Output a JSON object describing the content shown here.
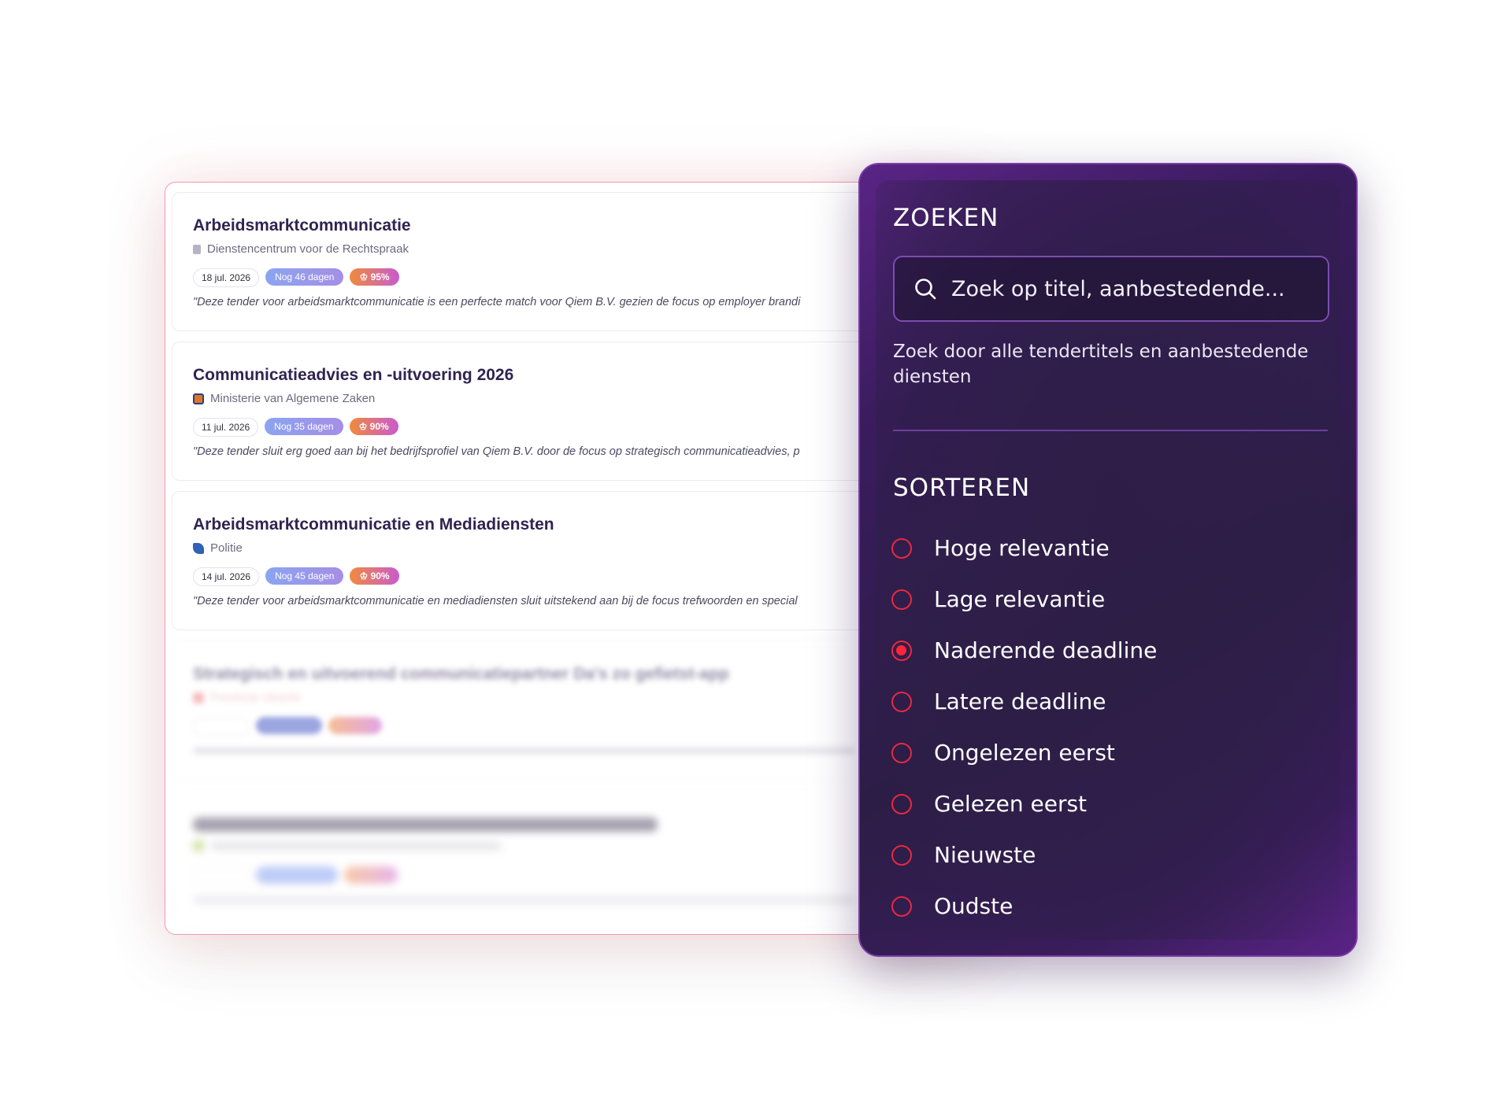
{
  "tenders": [
    {
      "title": "Arbeidsmarktcommunicatie",
      "org": "Dienstencentrum voor de Rechtspraak",
      "date": "18 jul. 2026",
      "days_left": "Nog 46 dagen",
      "score": "95%",
      "quote": "\"Deze tender voor arbeidsmarktcommunicatie is een perfecte match voor Qiem B.V. gezien de focus op employer brandi"
    },
    {
      "title": "Communicatieadvies en -uitvoering 2026",
      "org": "Ministerie van Algemene Zaken",
      "date": "11 jul. 2026",
      "days_left": "Nog 35 dagen",
      "score": "90%",
      "quote": "\"Deze tender sluit erg goed aan bij het bedrijfsprofiel van Qiem B.V. door de focus op strategisch communicatieadvies, p"
    },
    {
      "title": "Arbeidsmarktcommunicatie en Mediadiensten",
      "org": "Politie",
      "date": "14 jul. 2026",
      "days_left": "Nog 45 dagen",
      "score": "90%",
      "quote": "\"Deze tender voor arbeidsmarktcommunicatie en mediadiensten sluit uitstekend aan bij de focus trefwoorden en special"
    },
    {
      "title": "Strategisch en uitvoerend communicatiepartner Da's zo gefietst-app",
      "org": "Provincie Utrecht"
    }
  ],
  "search": {
    "heading": "ZOEKEN",
    "placeholder": "Zoek op titel, aanbestedende...",
    "help": "Zoek door alle tendertitels en aanbestedende diensten"
  },
  "sort": {
    "heading": "SORTEREN",
    "options": [
      {
        "label": "Hoge relevantie",
        "selected": false
      },
      {
        "label": "Lage relevantie",
        "selected": false
      },
      {
        "label": "Naderende deadline",
        "selected": true
      },
      {
        "label": "Latere deadline",
        "selected": false
      },
      {
        "label": "Ongelezen eerst",
        "selected": false
      },
      {
        "label": "Gelezen eerst",
        "selected": false
      },
      {
        "label": "Nieuwste",
        "selected": false
      },
      {
        "label": "Oudste",
        "selected": false
      }
    ]
  },
  "colors": {
    "accent_red": "#e8293f",
    "panel_purple": "#3a1c5e",
    "title_text": "#2f2450"
  },
  "icons": {
    "search": "search-icon",
    "score": "trophy-icon"
  }
}
